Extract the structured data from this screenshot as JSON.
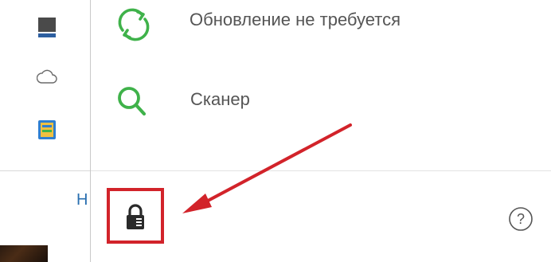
{
  "update_row": {
    "label": "Обновление не требуется",
    "icon": "refresh-icon"
  },
  "scanner_row": {
    "label": "Сканер",
    "icon": "search-icon"
  },
  "left_strip": {
    "partial_letter": "Н",
    "icons": [
      "monitor-icon",
      "cloud-icon",
      "app-icon"
    ]
  },
  "footer": {
    "lock_icon": "lock-icon",
    "help_icon": "help-icon",
    "help_glyph": "?"
  },
  "colors": {
    "accent_green": "#3fb24a",
    "highlight_red": "#d2232a",
    "text_gray": "#555555"
  }
}
